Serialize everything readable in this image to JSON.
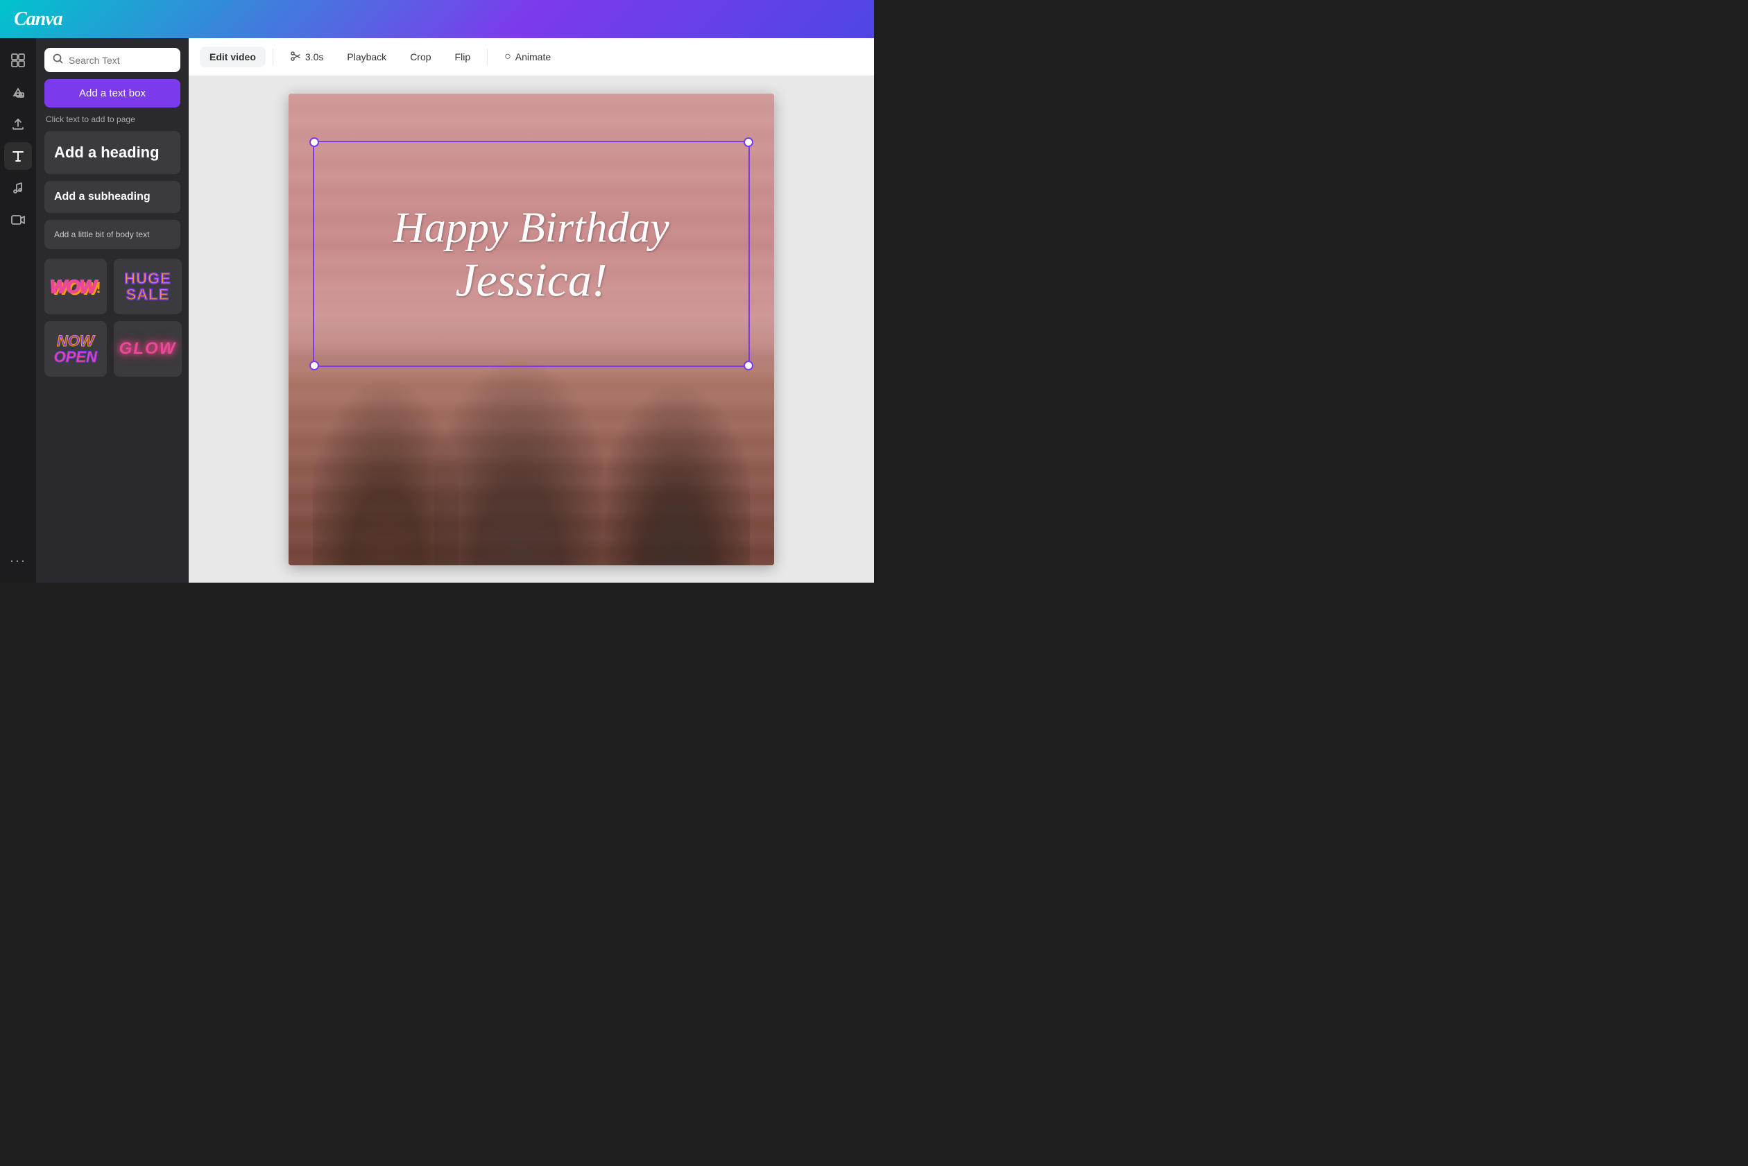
{
  "header": {
    "logo": "Canva"
  },
  "iconSidebar": {
    "icons": [
      {
        "name": "layout-icon",
        "symbol": "⊞",
        "active": false
      },
      {
        "name": "elements-icon",
        "symbol": "◇▲",
        "active": false
      },
      {
        "name": "upload-icon",
        "symbol": "↑",
        "active": false
      },
      {
        "name": "text-icon",
        "symbol": "T",
        "active": true
      },
      {
        "name": "music-icon",
        "symbol": "♪",
        "active": false
      },
      {
        "name": "video-icon",
        "symbol": "▶",
        "active": false
      },
      {
        "name": "more-icon",
        "symbol": "···",
        "active": false
      }
    ]
  },
  "textPanel": {
    "search": {
      "placeholder": "Search Text",
      "value": ""
    },
    "addTextBoxLabel": "Add a text box",
    "clickHint": "Click text to add to page",
    "headingLabel": "Add a heading",
    "subheadingLabel": "Add a subheading",
    "bodyLabel": "Add a little bit of body text",
    "presets": [
      {
        "id": "wow",
        "label": "WOW!"
      },
      {
        "id": "huge-sale",
        "label": "HUGE SALE"
      },
      {
        "id": "now-open",
        "label": "NOW OPEN"
      },
      {
        "id": "glow",
        "label": "GLOW"
      }
    ]
  },
  "toolbar": {
    "editVideoLabel": "Edit video",
    "durationLabel": "3.0s",
    "playbackLabel": "Playback",
    "cropLabel": "Crop",
    "flipLabel": "Flip",
    "animateLabel": "Animate"
  },
  "canvas": {
    "birthdayLine1": "Happy Birthday",
    "birthdayLine2": "Jessica!"
  }
}
